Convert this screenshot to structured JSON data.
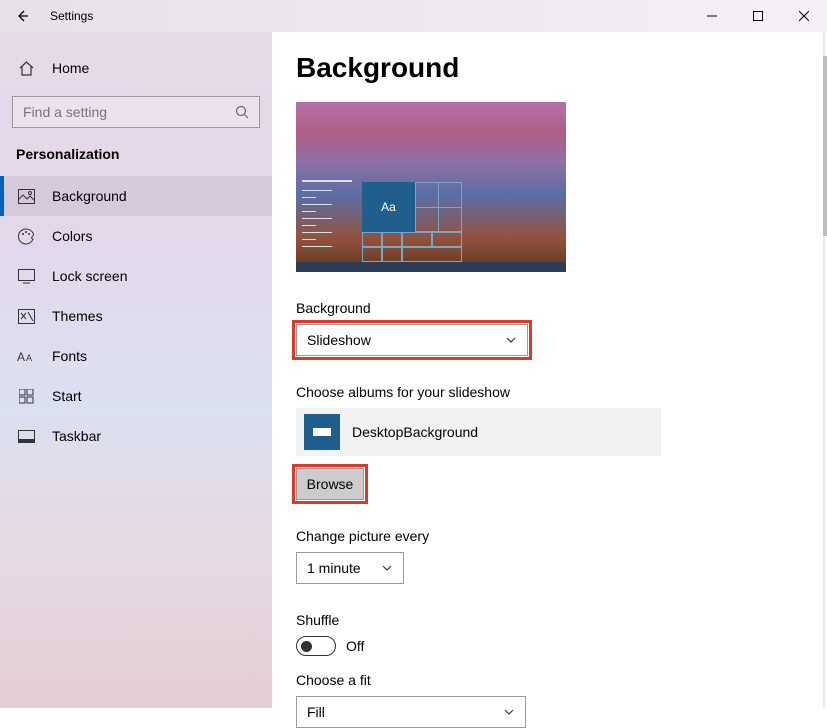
{
  "window": {
    "title": "Settings"
  },
  "sidebar": {
    "home": "Home",
    "search_placeholder": "Find a setting",
    "section": "Personalization",
    "items": [
      {
        "label": "Background",
        "icon": "picture-icon",
        "active": true
      },
      {
        "label": "Colors",
        "icon": "palette-icon",
        "active": false
      },
      {
        "label": "Lock screen",
        "icon": "lockscreen-icon",
        "active": false
      },
      {
        "label": "Themes",
        "icon": "themes-icon",
        "active": false
      },
      {
        "label": "Fonts",
        "icon": "fonts-icon",
        "active": false
      },
      {
        "label": "Start",
        "icon": "start-icon",
        "active": false
      },
      {
        "label": "Taskbar",
        "icon": "taskbar-icon",
        "active": false
      }
    ]
  },
  "main": {
    "title": "Background",
    "preview_tile_text": "Aa",
    "background_label": "Background",
    "background_value": "Slideshow",
    "albums_label": "Choose albums for your slideshow",
    "album_name": "DesktopBackground",
    "browse_label": "Browse",
    "change_label": "Change picture every",
    "change_value": "1 minute",
    "shuffle_label": "Shuffle",
    "shuffle_state": "Off",
    "fit_label": "Choose a fit",
    "fit_value": "Fill"
  }
}
